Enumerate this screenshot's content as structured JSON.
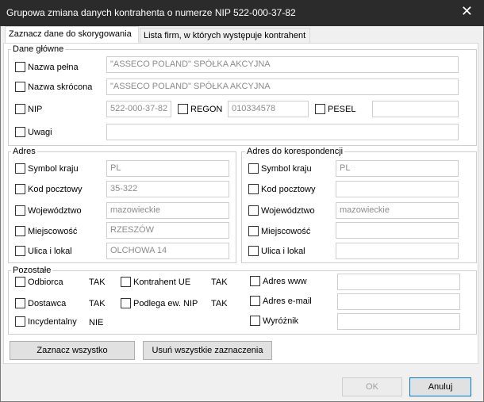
{
  "window": {
    "title": "Grupowa zmiana danych kontrahenta o numerze NIP 522-000-37-82"
  },
  "tabs": [
    {
      "label": "Zaznacz dane do skorygowania",
      "active": true
    },
    {
      "label": "Lista firm, w których występuje kontrahent",
      "active": false
    }
  ],
  "main_group": {
    "legend": "Dane główne",
    "nazwa_pelna": {
      "label": "Nazwa pełna",
      "value": "\"ASSECO POLAND\" SPÓŁKA AKCYJNA"
    },
    "nazwa_skrocona": {
      "label": "Nazwa skrócona",
      "value": "\"ASSECO POLAND\" SPÓŁKA AKCYJNA"
    },
    "nip": {
      "label": "NIP",
      "value": "522-000-37-82"
    },
    "regon": {
      "label": "REGON",
      "value": "010334578"
    },
    "pesel": {
      "label": "PESEL",
      "value": ""
    },
    "uwagi": {
      "label": "Uwagi",
      "value": ""
    }
  },
  "address_group": {
    "legend": "Adres",
    "fields": [
      {
        "label": "Symbol kraju",
        "value": "PL"
      },
      {
        "label": "Kod pocztowy",
        "value": "35-322"
      },
      {
        "label": "Województwo",
        "value": "mazowieckie"
      },
      {
        "label": "Miejscowość",
        "value": "RZESZÓW"
      },
      {
        "label": "Ulica i lokal",
        "value": "OLCHOWA 14"
      }
    ]
  },
  "correspondence_group": {
    "legend": "Adres do korespondencji",
    "fields": [
      {
        "label": "Symbol kraju",
        "value": "PL"
      },
      {
        "label": "Kod pocztowy",
        "value": ""
      },
      {
        "label": "Województwo",
        "value": "mazowieckie"
      },
      {
        "label": "Miejscowość",
        "value": ""
      },
      {
        "label": "Ulica i lokal",
        "value": ""
      }
    ]
  },
  "other_group": {
    "legend": "Pozostałe",
    "odbiorca": {
      "label": "Odbiorca",
      "value": "TAK"
    },
    "dostawca": {
      "label": "Dostawca",
      "value": "TAK"
    },
    "incydentalny": {
      "label": "Incydentalny",
      "value": "NIE"
    },
    "kontrahent_ue": {
      "label": "Kontrahent UE",
      "value": "TAK"
    },
    "podlega_nip": {
      "label": "Podlega ew. NIP",
      "value": "TAK"
    },
    "adres_www": {
      "label": "Adres www",
      "value": ""
    },
    "adres_email": {
      "label": "Adres e-mail",
      "value": ""
    },
    "wyroznik": {
      "label": "Wyróżnik",
      "value": ""
    }
  },
  "actions": {
    "select_all": "Zaznacz wszystko",
    "clear_all": "Usuń wszystkie zaznaczenia",
    "ok": "OK",
    "cancel": "Anuluj"
  },
  "icons": {
    "close": "close-icon"
  }
}
